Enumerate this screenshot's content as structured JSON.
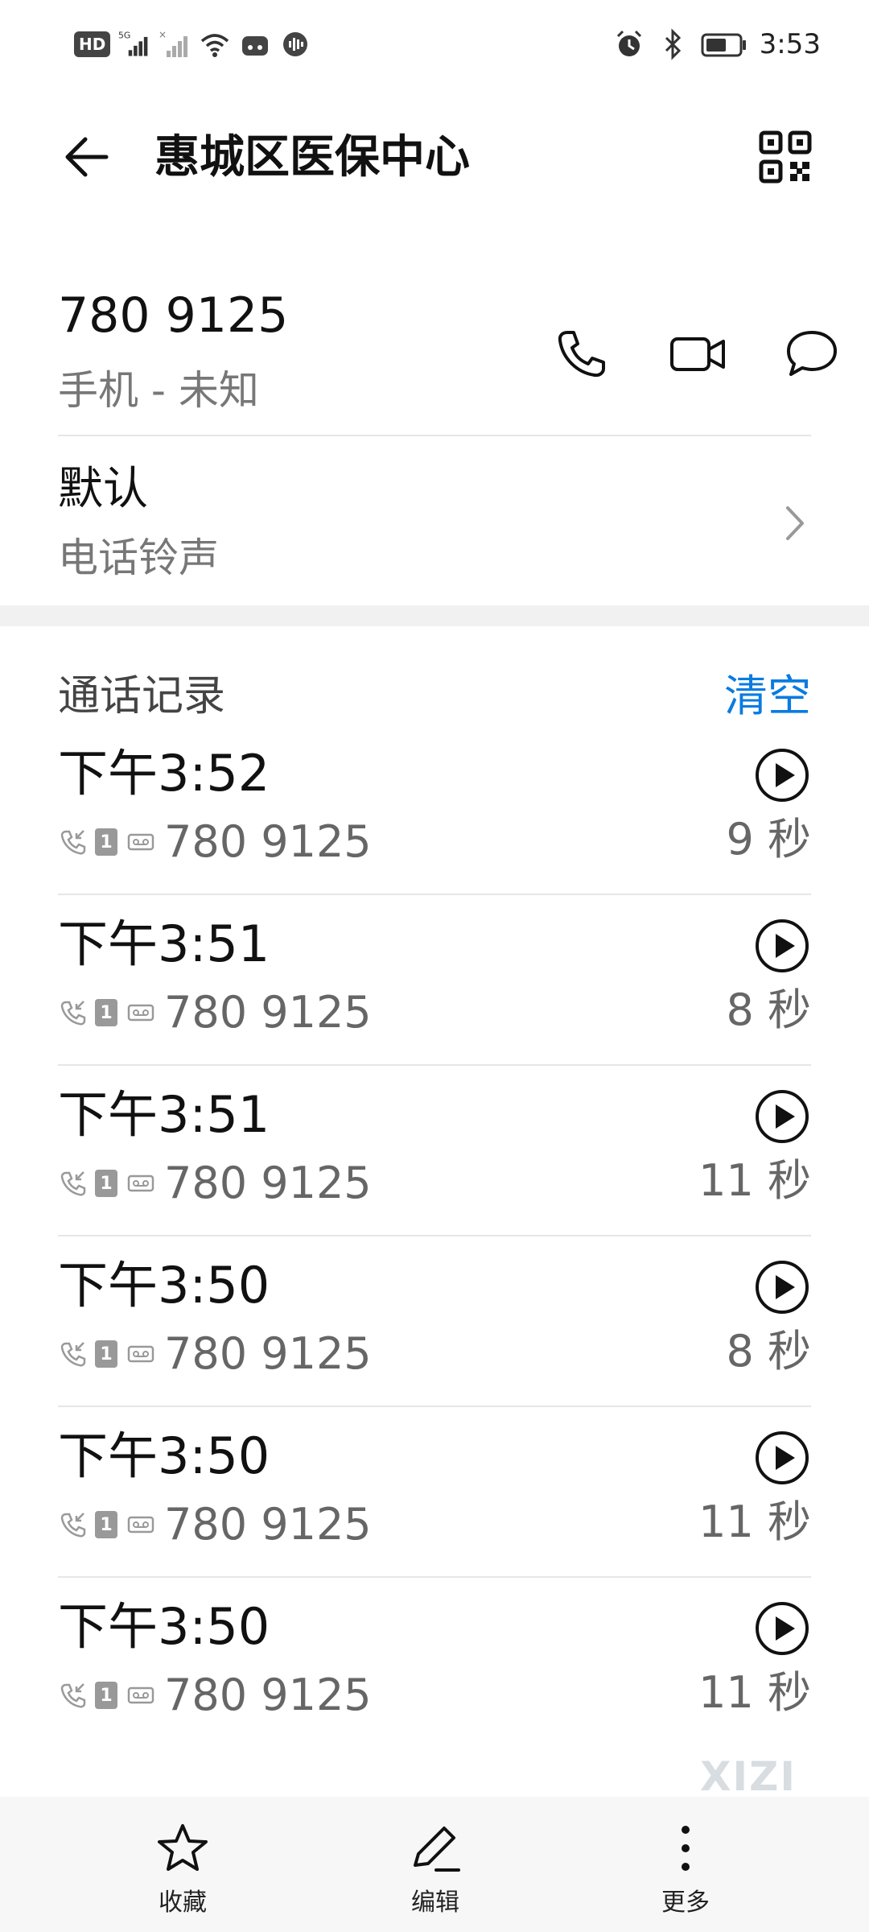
{
  "status_bar": {
    "hd_label": "HD",
    "network_label": "5G",
    "time": "3:53"
  },
  "header": {
    "title": "惠城区医保中心"
  },
  "contact": {
    "number": "780 9125",
    "type": "手机 - 未知"
  },
  "ringtone": {
    "value": "默认",
    "label": "电话铃声"
  },
  "call_log": {
    "title": "通话记录",
    "clear_label": "清空",
    "entries": [
      {
        "time": "下午3:52",
        "sim": "1",
        "number": "780 9125",
        "duration": "9 秒"
      },
      {
        "time": "下午3:51",
        "sim": "1",
        "number": "780 9125",
        "duration": "8 秒"
      },
      {
        "time": "下午3:51",
        "sim": "1",
        "number": "780 9125",
        "duration": "11 秒"
      },
      {
        "time": "下午3:50",
        "sim": "1",
        "number": "780 9125",
        "duration": "8 秒"
      },
      {
        "time": "下午3:50",
        "sim": "1",
        "number": "780 9125",
        "duration": "11 秒"
      },
      {
        "time": "下午3:50",
        "sim": "1",
        "number": "780 9125",
        "duration": "11 秒"
      }
    ]
  },
  "watermark": "XIZI",
  "bottom_bar": {
    "favorite_label": "收藏",
    "edit_label": "编辑",
    "more_label": "更多"
  },
  "icons": {
    "back": "arrow-left-icon",
    "qr": "qr-code-icon",
    "call": "phone-icon",
    "video": "video-camera-icon",
    "message": "message-bubble-icon",
    "play": "play-circle-icon",
    "favorite": "star-icon",
    "edit": "pencil-icon",
    "more": "more-vertical-icon"
  },
  "colors": {
    "accent": "#0a7be0",
    "divider": "#e6e6e6",
    "secondary_text": "#777777"
  }
}
